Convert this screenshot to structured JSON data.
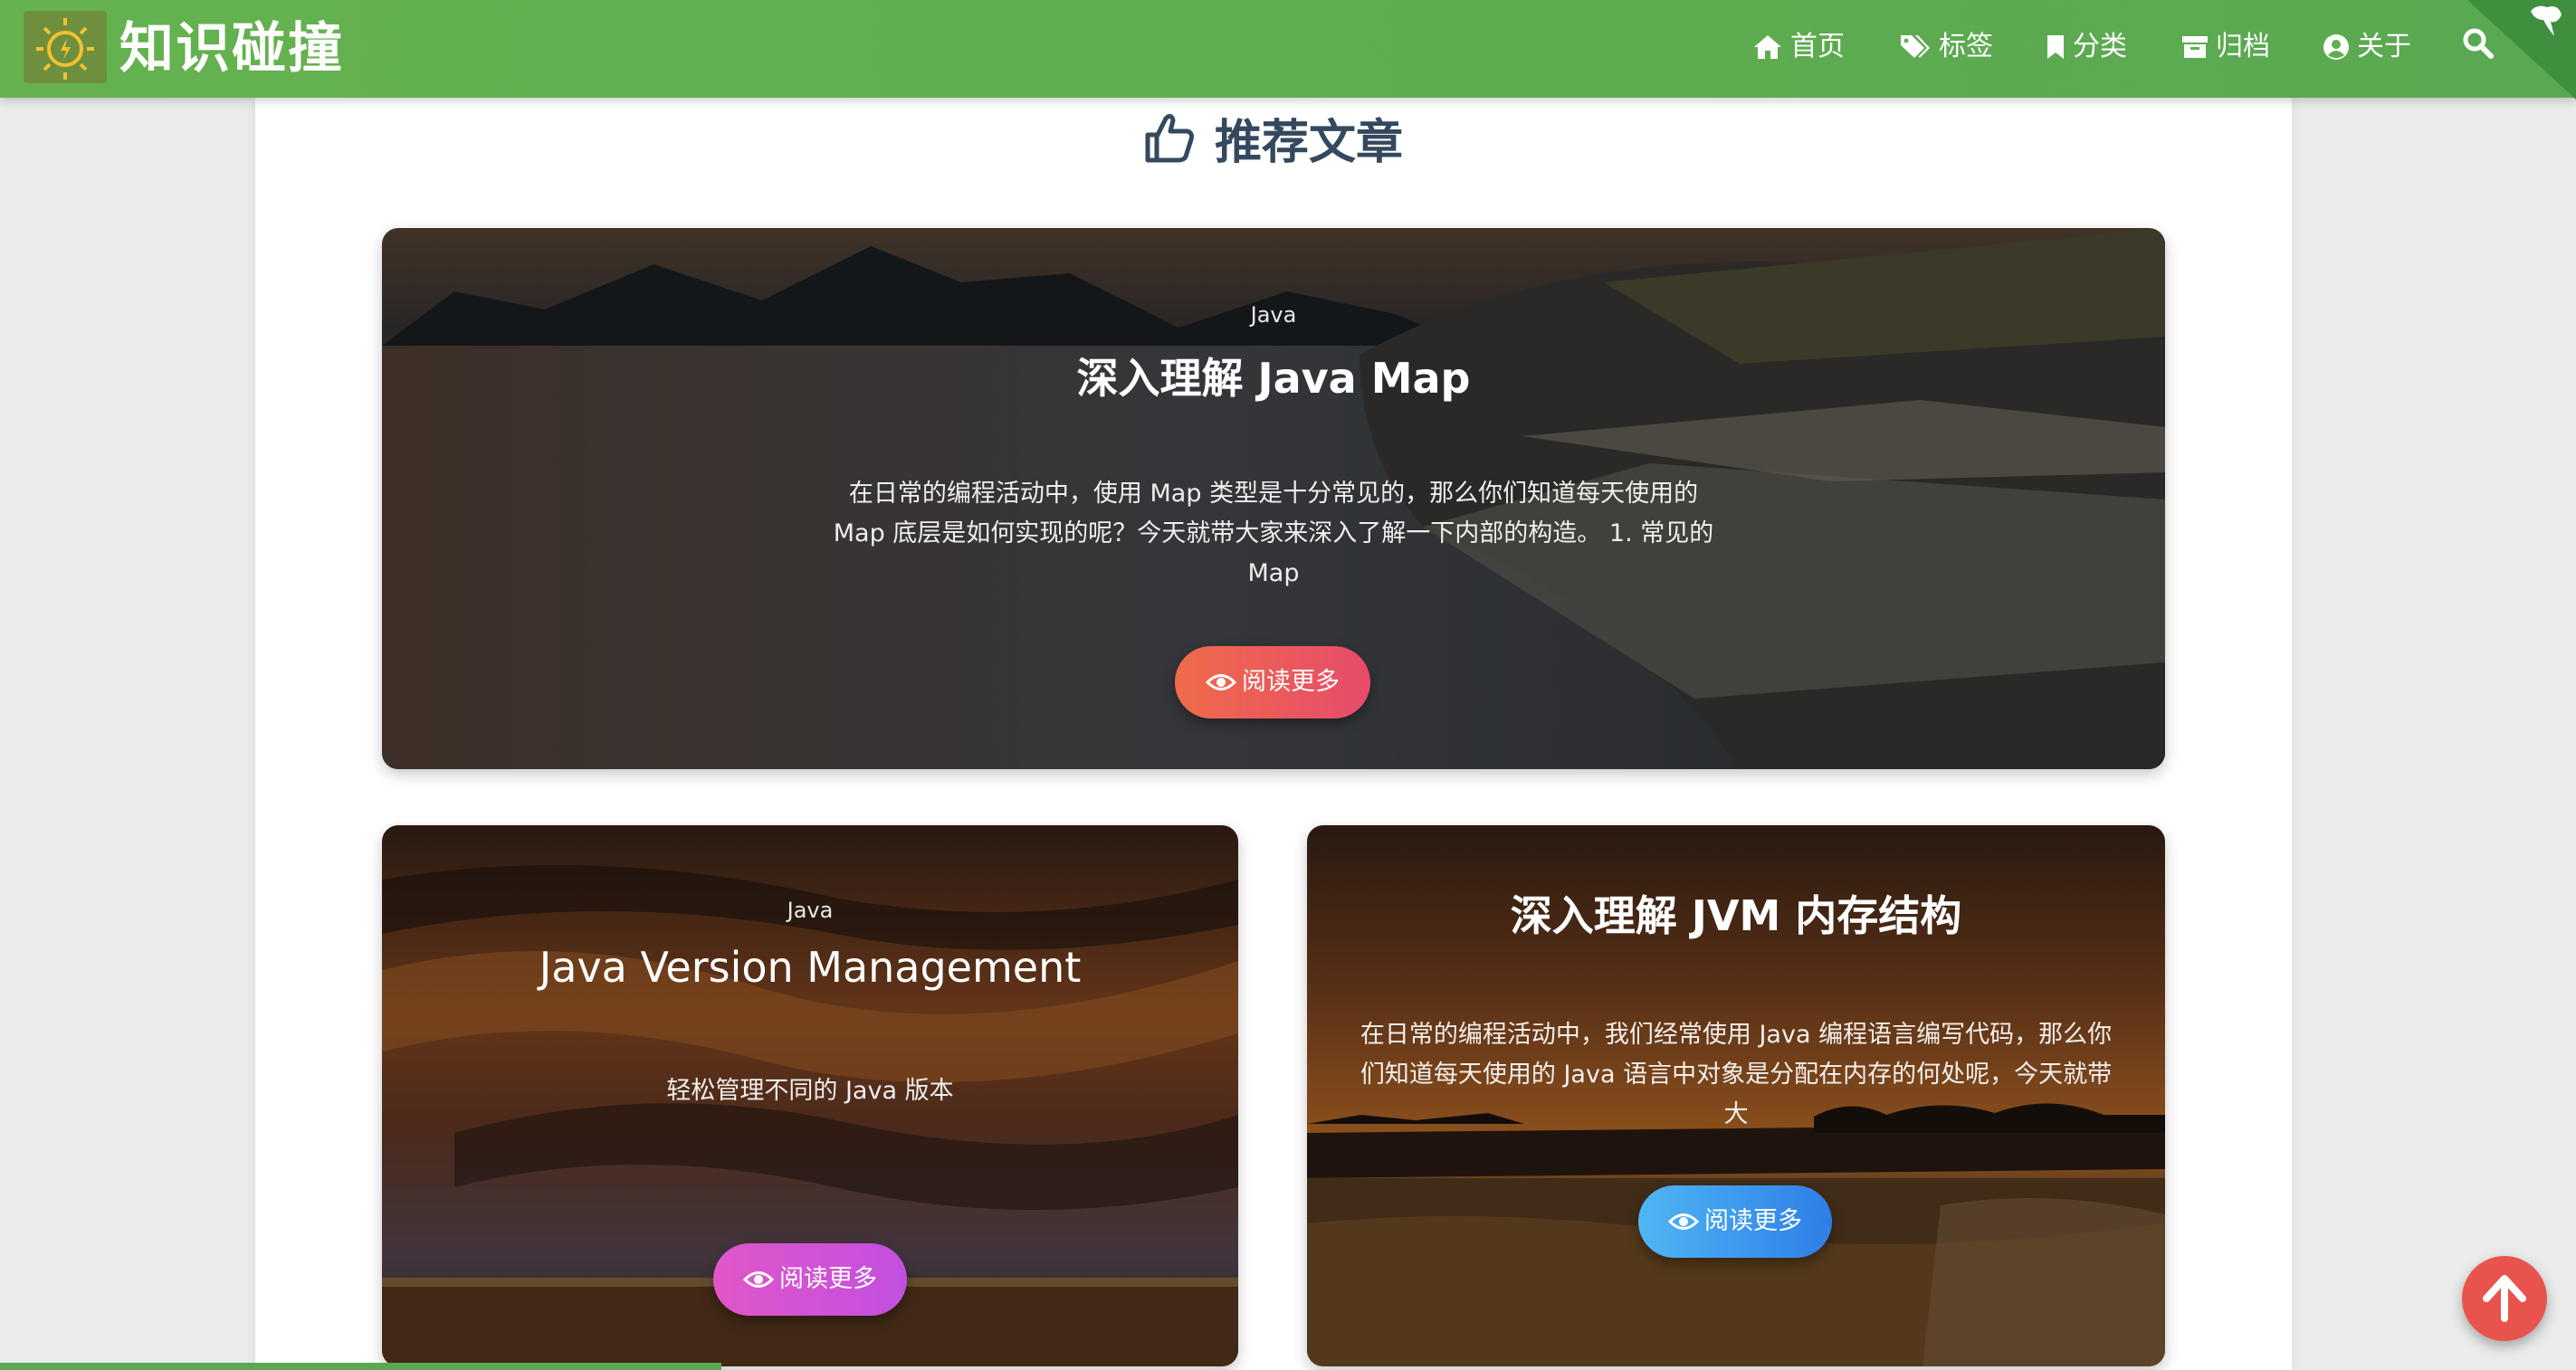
{
  "header": {
    "brand": "知识碰撞",
    "nav": [
      {
        "label": "首页",
        "icon": "home-icon"
      },
      {
        "label": "标签",
        "icon": "tags-icon"
      },
      {
        "label": "分类",
        "icon": "bookmark-icon"
      },
      {
        "label": "归档",
        "icon": "archive-icon"
      },
      {
        "label": "关于",
        "icon": "user-circle-icon"
      }
    ],
    "search_icon": "search-icon",
    "brand_color": "#5aa851"
  },
  "section": {
    "title": "推荐文章",
    "icon": "thumbs-up-icon"
  },
  "cards": [
    {
      "category": "Java",
      "title": "深入理解 Java Map",
      "summary_lines": [
        "在日常的编程活动中，使用 Map 类型是十分常见的，那么你们知道每天使用的",
        "Map 底层是如何实现的呢？今天就带大家来深入了解一下内部的构造。 1. 常见的",
        "Map"
      ],
      "button": "阅读更多",
      "button_color": "#ee5f4f"
    },
    {
      "category": "Java",
      "title": "Java Version Management",
      "summary_lines": [
        "轻松管理不同的 Java 版本"
      ],
      "button": "阅读更多",
      "button_color": "#d65ad4"
    },
    {
      "category": "",
      "title": "深入理解 JVM 内存结构",
      "summary_lines": [
        "在日常的编程活动中，我们经常使用 Java 编程语言编写代码，那么你",
        "们知道每天使用的 Java 语言中对象是分配在内存的何处呢，今天就带",
        "大"
      ],
      "button": "阅读更多",
      "button_color": "#3f9af0"
    }
  ],
  "back_to_top_icon": "arrow-up-icon",
  "reading_progress": 0.28
}
